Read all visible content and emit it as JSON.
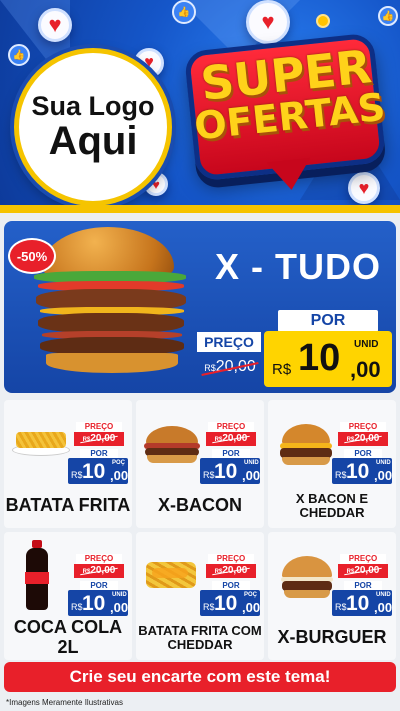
{
  "header": {
    "logo_line1": "Sua Logo",
    "logo_line2": "Aqui",
    "title_line1": "SUPER",
    "title_line2": "OFERTAS"
  },
  "featured": {
    "discount": "-50%",
    "name": "X - TUDO",
    "old_label": "PREÇO",
    "old_currency": "R$",
    "old_price": "20,00",
    "new_label": "POR",
    "currency": "R$",
    "price_int": "10",
    "price_dec": ",00",
    "unit": "UNID"
  },
  "products": [
    {
      "name": "BATATA FRITA",
      "old_label": "PREÇO",
      "old_currency": "R$",
      "old_price": "20,00",
      "new_label": "POR",
      "currency": "R$",
      "price_int": "10",
      "price_dec": ",00",
      "unit": "POÇ"
    },
    {
      "name": "X-BACON",
      "old_label": "PREÇO",
      "old_currency": "R$",
      "old_price": "20,00",
      "new_label": "POR",
      "currency": "R$",
      "price_int": "10",
      "price_dec": ",00",
      "unit": "UNID"
    },
    {
      "name": "X BACON E CHEDDAR",
      "old_label": "PREÇO",
      "old_currency": "R$",
      "old_price": "20,00",
      "new_label": "POR",
      "currency": "R$",
      "price_int": "10",
      "price_dec": ",00",
      "unit": "UNID"
    },
    {
      "name": "COCA COLA 2L",
      "old_label": "PREÇO",
      "old_currency": "R$",
      "old_price": "20,00",
      "new_label": "POR",
      "currency": "R$",
      "price_int": "10",
      "price_dec": ",00",
      "unit": "UNID"
    },
    {
      "name": "BATATA FRITA COM CHEDDAR",
      "old_label": "PREÇO",
      "old_currency": "R$",
      "old_price": "20,00",
      "new_label": "POR",
      "currency": "R$",
      "price_int": "10",
      "price_dec": ",00",
      "unit": "POÇ"
    },
    {
      "name": "X-BURGUER",
      "old_label": "PREÇO",
      "old_currency": "R$",
      "old_price": "20,00",
      "new_label": "POR",
      "currency": "R$",
      "price_int": "10",
      "price_dec": ",00",
      "unit": "UNID"
    }
  ],
  "cta": "Crie seu encarte com este tema!",
  "footnote": "*Imagens Meramente Ilustrativas",
  "colors": {
    "brand_blue": "#1545a6",
    "accent_red": "#e8202a",
    "accent_yellow": "#ffd400"
  }
}
